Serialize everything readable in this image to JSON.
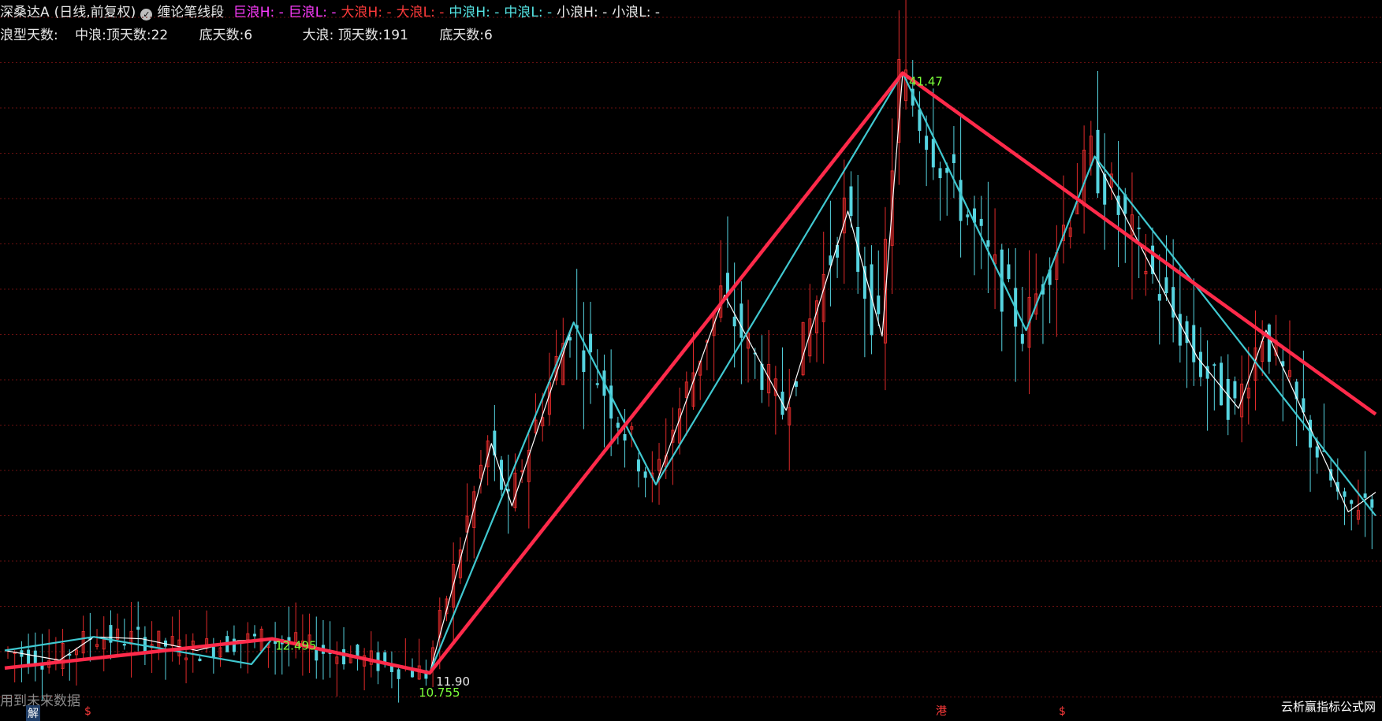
{
  "header": {
    "stock": "深桑达A",
    "period": "(日线,前复权)",
    "indicator": "缠论笔线段",
    "legend": [
      {
        "text": "巨浪H: -",
        "color": "#ff3cff"
      },
      {
        "text": "巨浪L: -",
        "color": "#ff3cff"
      },
      {
        "text": "大浪H: -",
        "color": "#ff3b3b"
      },
      {
        "text": "大浪L: -",
        "color": "#ff3b3b"
      },
      {
        "text": "中浪H: -",
        "color": "#55e3e3"
      },
      {
        "text": "中浪L: -",
        "color": "#55e3e3"
      },
      {
        "text": "小浪H: -",
        "color": "#e8e8e8"
      },
      {
        "text": "小浪L: -",
        "color": "#e8e8e8"
      }
    ]
  },
  "stats": {
    "label": "浪型天数:",
    "mid_top": "中浪:顶天数:22",
    "mid_bottom": "底天数:6",
    "big_top": "大浪: 顶天数:191",
    "big_bottom": "底天数:6"
  },
  "price_labels": {
    "high_main": "41.47",
    "high_mid": "12.495",
    "low_a": "11.90",
    "low_b": "10.755"
  },
  "footer": {
    "future_note": "用到未来数据",
    "watermark": "云析赢指标公式网",
    "marks": [
      "解",
      "$",
      "港",
      "$"
    ]
  },
  "colors": {
    "background": "#000000",
    "grid": "#6a1010",
    "up": "#e02a2a",
    "down": "#56d4e0",
    "big_wave": "#ff2a4a",
    "mid_wave": "#40c8d0",
    "small_wave": "#ffffff",
    "high_label": "#7bff3a"
  },
  "chart_data": {
    "type": "line",
    "title": "",
    "xlabel": "",
    "ylabel": "",
    "ylim": [
      9.5,
      44
    ],
    "x_count": 200,
    "series": [
      {
        "name": "大浪",
        "points": [
          [
            0,
            11.0
          ],
          [
            39,
            12.5
          ],
          [
            62,
            10.75
          ],
          [
            131,
            41.47
          ],
          [
            200,
            24.0
          ]
        ]
      },
      {
        "name": "中浪",
        "points": [
          [
            0,
            11.9
          ],
          [
            13,
            12.6
          ],
          [
            36,
            11.2
          ],
          [
            39,
            12.5
          ],
          [
            62,
            10.75
          ],
          [
            83,
            28.7
          ],
          [
            95,
            20.4
          ],
          [
            131,
            41.47
          ],
          [
            149,
            28.3
          ],
          [
            159,
            37.2
          ],
          [
            200,
            18.8
          ]
        ]
      },
      {
        "name": "小浪",
        "points": [
          [
            0,
            11.9
          ],
          [
            8,
            11.4
          ],
          [
            13,
            12.6
          ],
          [
            20,
            12.5
          ],
          [
            28,
            11.9
          ],
          [
            34,
            12.4
          ],
          [
            39,
            12.5
          ],
          [
            62,
            10.75
          ],
          [
            71,
            22.5
          ],
          [
            74,
            19.3
          ],
          [
            83,
            28.7
          ],
          [
            95,
            20.4
          ],
          [
            105,
            30.1
          ],
          [
            114,
            24.2
          ],
          [
            123,
            34.4
          ],
          [
            128,
            28.0
          ],
          [
            131,
            41.47
          ],
          [
            149,
            28.3
          ],
          [
            159,
            37.2
          ],
          [
            174,
            26.9
          ],
          [
            180,
            24.3
          ],
          [
            184,
            28.3
          ],
          [
            196,
            19.0
          ],
          [
            200,
            20.0
          ]
        ]
      }
    ],
    "candles": "generated"
  }
}
